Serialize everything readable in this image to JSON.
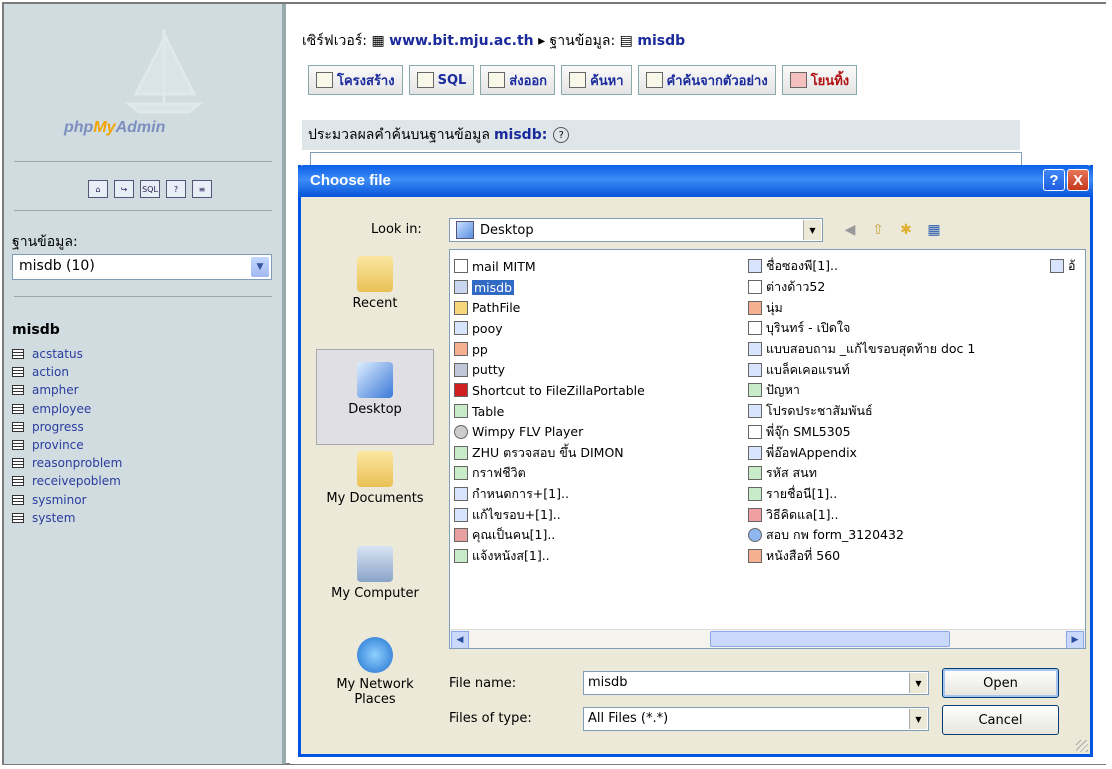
{
  "pma": {
    "logo_php": "php",
    "logo_my": "My",
    "logo_admin": "Admin",
    "db_label": "ฐานข้อมูล:",
    "db_select": "misdb (10)",
    "db_name": "misdb",
    "tables": [
      "acstatus",
      "action",
      "ampher",
      "employee",
      "progress",
      "province",
      "reasonproblem",
      "receivepoblem",
      "sysminor",
      "system"
    ]
  },
  "header": {
    "server_label": "เซิร์ฟเวอร์:",
    "server": "www.bit.mju.ac.th",
    "db_label": "ฐานข้อมูล:",
    "db": "misdb",
    "tabs": [
      "โครงสร้าง",
      "SQL",
      "ส่งออก",
      "ค้นหา",
      "คำค้นจากตัวอย่าง",
      "โยนทิ้ง"
    ],
    "query_title": "ประมวลผลคำค้นบนฐานข้อมูล",
    "query_db": "misdb:"
  },
  "dialog": {
    "title": "Choose file",
    "help": "?",
    "close": "X",
    "look_in_label": "Look in:",
    "look_in": "Desktop",
    "places": [
      "Recent",
      "Desktop",
      "My Documents",
      "My Computer",
      "My Network Places"
    ],
    "col1": [
      "mail MITM",
      "misdb",
      "PathFile",
      "pooy",
      "pp",
      "putty",
      "Shortcut to FileZillaPortable",
      "Table",
      "Wimpy FLV Player",
      "ZHU ตรวจสอบ ขึ้น DIMON",
      "กราฟชีวิต",
      "กำหนดการ+[1]..",
      "แก้ไขรอบ+[1]..",
      "คุณเป็นคน[1]..",
      "แจ้งหนังส[1].."
    ],
    "col2": [
      "ชื่อซองพี[1]..",
      "ต่างด้าว52",
      "นุ่ม",
      "บุรินทร์ - เปิดใจ",
      "แบบสอบถาม _แก้ไขรอบสุดท้าย doc 1",
      "แบล็คเคอแรนท์",
      "ปัญหา",
      "โปรดประชาสัมพันธ์",
      "พี่จุ๊ก SML5305",
      "พี่อ๊อฟAppendix",
      "รหัส สนท",
      "รายชื่อนี[1]..",
      "วิธีคิดแล[1]..",
      "สอบ กพ form_3120432",
      "หนังสือที่ 560"
    ],
    "col3": [
      "อ้"
    ],
    "file_name_label": "File name:",
    "file_name": "misdb",
    "file_type_label": "Files of type:",
    "file_type": "All Files (*.*)",
    "open": "Open",
    "cancel": "Cancel"
  }
}
